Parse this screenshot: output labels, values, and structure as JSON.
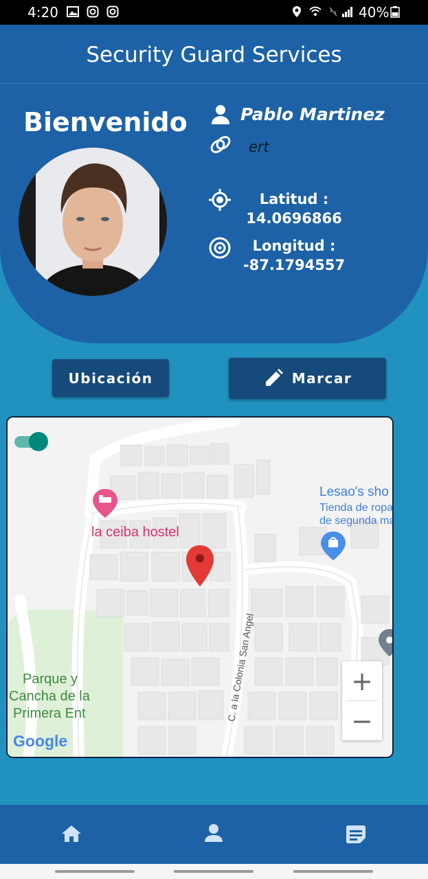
{
  "status_bar": {
    "time": "4:20",
    "battery": "40%"
  },
  "app_bar": {
    "title": "Security Guard Services"
  },
  "profile": {
    "welcome": "Bienvenido",
    "name": "Pablo Martinez",
    "subtitle": "ert",
    "latitude_label": "Latitud :",
    "latitude_value": "14.0696866",
    "longitude_label": "Longitud :",
    "longitude_value": "-87.1794557"
  },
  "actions": {
    "location_button": "Ubicación",
    "mark_button": "Marcar"
  },
  "map": {
    "toggle_on": true,
    "hostel_label": "la ceiba hostel",
    "shop_name": "Lesao's sho",
    "shop_sub1": "Tienda de ropa",
    "shop_sub2": "de segunda ma",
    "park_line1": "Parque y",
    "park_line2": "Cancha de la",
    "park_line3": "Primera Ent",
    "street_label": "C. a la Colonia San Angel",
    "google_logo": "Google",
    "zoom_in": "+",
    "zoom_out": "−"
  },
  "bottom_nav": {
    "items": [
      "home-icon",
      "person-icon",
      "document-icon"
    ]
  },
  "colors": {
    "primary": "#1d62a6",
    "background": "#2192c0",
    "button": "#164a7a",
    "pin": "#e53935",
    "toggle": "#00897b"
  }
}
